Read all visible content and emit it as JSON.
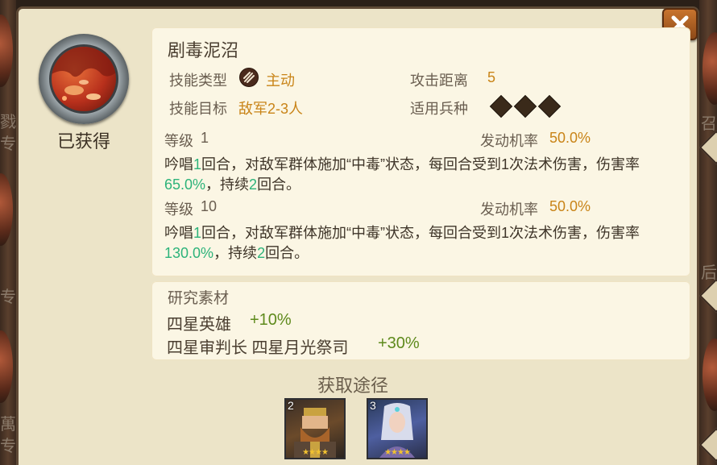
{
  "skill": {
    "name": "剧毒泥沼",
    "status": "已获得",
    "type_label": "技能类型",
    "type_value": "主动",
    "range_label": "攻击距离",
    "range_value": "5",
    "target_label": "技能目标",
    "target_value": "敌军2-3人",
    "troop_label": "适用兵种",
    "troop_icons": [
      "sword-icon",
      "shield-icon",
      "bow-icon"
    ]
  },
  "levels": [
    {
      "level_label": "等级",
      "level_value": "1",
      "rate_label": "发动机率",
      "rate_value": "50.0%",
      "desc_parts": [
        "吟唱",
        "1",
        "回合，对敌军群体施加“中毒”状态，每回合受到1次法术伤害，伤害率",
        "65.0%",
        "，持续",
        "2",
        "回合。"
      ]
    },
    {
      "level_label": "等级",
      "level_value": "10",
      "rate_label": "发动机率",
      "rate_value": "50.0%",
      "desc_parts": [
        "吟唱",
        "1",
        "回合，对敌军群体施加“中毒”状态，每回合受到1次法术伤害，伤害率",
        "130.0%",
        "，持续",
        "2",
        "回合。"
      ]
    }
  ],
  "research": {
    "title": "研究素材",
    "rows": [
      {
        "text": "四星英雄",
        "bonus": "+10%"
      },
      {
        "text": "四星审判长 四星月光祭司",
        "bonus": "+30%"
      }
    ]
  },
  "obtain": {
    "title": "获取途径",
    "cards": [
      {
        "level": "2",
        "stars": "★★★★"
      },
      {
        "level": "3",
        "stars": "★★★★"
      }
    ]
  },
  "background": {
    "left_texts": [
      "戮",
      "专",
      "专",
      "萬",
      "专"
    ],
    "right_texts": [
      "召",
      "后"
    ]
  },
  "colors": {
    "accent_orange": "#c98418",
    "highlight_green": "#2db37a",
    "bonus_olive": "#5e8a1c",
    "dialog_bg": "#ece4c8",
    "panel_bg": "#fbf6e4"
  }
}
